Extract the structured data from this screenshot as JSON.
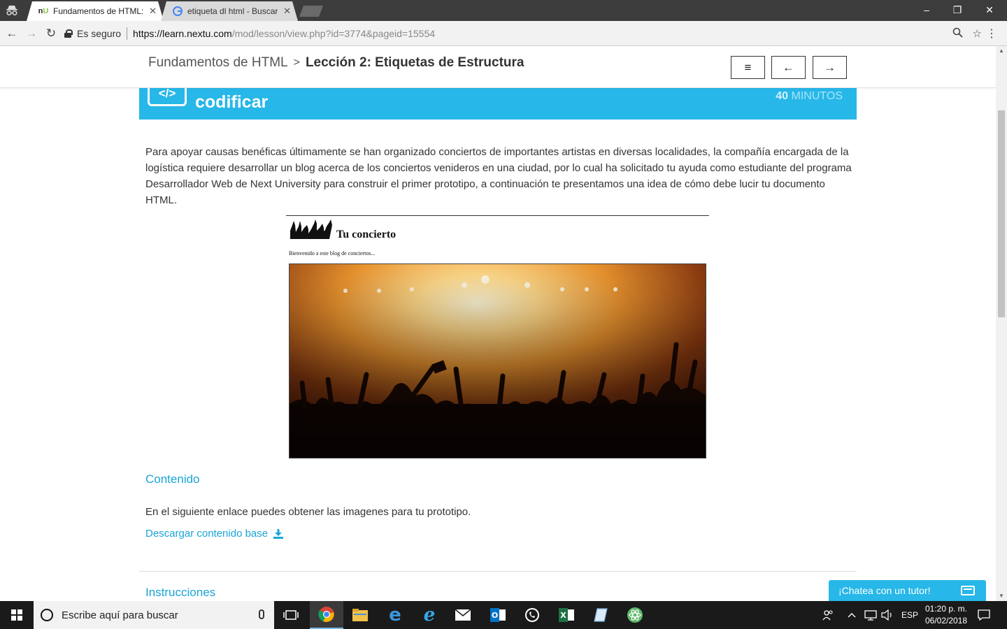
{
  "browser": {
    "tabs": [
      {
        "label": "Fundamentos de HTML: L",
        "active": true,
        "favicon": "nextu-favicon"
      },
      {
        "label": "etiqueta dl html - Buscar",
        "active": false,
        "favicon": "google-favicon"
      }
    ],
    "security_label": "Es seguro",
    "url_scheme": "https://",
    "url_host": "learn.nextu.com",
    "url_path": "/mod/lesson/view.php?id=3774&pageid=15554"
  },
  "header": {
    "course": "Fundamentos de HTML",
    "separator": ">",
    "lesson": "Lección 2: Etiquetas de Estructura",
    "buttons": {
      "menu": "≡",
      "prev": "←",
      "next": "→"
    }
  },
  "banner": {
    "icon_text": "</>",
    "title": "codificar",
    "minutes_value": "40",
    "minutes_label": "MINUTOS",
    "color": "#27b7e8"
  },
  "intro": "Para apoyar causas benéficas últimamente se han organizado conciertos de importantes artistas en diversas localidades, la compañía encargada de la logística requiere desarrollar un blog acerca de los conciertos venideros en una ciudad, por lo cual ha solicitado tu ayuda como estudiante del programa Desarrollador Web de Next University para construir el primer prototipo, a continuación te presentamos una idea de cómo debe lucir tu documento HTML.",
  "mockup": {
    "title": "Tu concierto",
    "subtitle": "Bienvenido a este blog de conciertos..."
  },
  "contenido": {
    "heading": "Contenido",
    "text": "En el siguiente enlace puedes obtener las imagenes para tu prototipo.",
    "link": "Descargar contenido base"
  },
  "instrucciones": {
    "heading": "Instrucciones"
  },
  "chat": {
    "label": "¡Chatea con un tutor!"
  },
  "taskbar": {
    "search_placeholder": "Escribe aquí para buscar",
    "language": "ESP",
    "time": "01:20 p. m.",
    "date": "06/02/2018"
  },
  "colors": {
    "accent": "#27b7e8",
    "link": "#1aa5d6"
  }
}
